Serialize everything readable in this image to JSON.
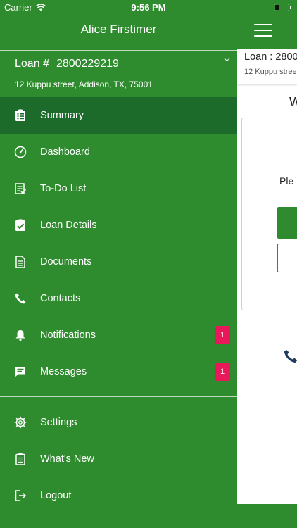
{
  "status_bar": {
    "carrier": "Carrier",
    "time": "9:56 PM"
  },
  "header": {
    "title": "Alice Firstimer"
  },
  "loan": {
    "label": "Loan #",
    "number": "2800229219",
    "address": "12 Kuppu street, Addison, TX, 75001"
  },
  "menu": {
    "items": [
      {
        "label": "Summary",
        "icon": "clipboard-list-icon"
      },
      {
        "label": "Dashboard",
        "icon": "gauge-icon"
      },
      {
        "label": "To-Do List",
        "icon": "checklist-icon"
      },
      {
        "label": "Loan Details",
        "icon": "clipboard-check-icon"
      },
      {
        "label": "Documents",
        "icon": "document-icon"
      },
      {
        "label": "Contacts",
        "icon": "phone-icon"
      },
      {
        "label": "Notifications",
        "icon": "bell-icon",
        "badge": "1"
      },
      {
        "label": "Messages",
        "icon": "chat-icon",
        "badge": "1"
      }
    ],
    "secondary": [
      {
        "label": "Settings",
        "icon": "gear-icon"
      },
      {
        "label": "What's New",
        "icon": "clipboard-icon"
      },
      {
        "label": "Logout",
        "icon": "logout-icon"
      }
    ]
  },
  "content": {
    "loan_header": "Loan : 2800",
    "loan_address": "12 Kuppu stree",
    "heading_fragment": "W",
    "text_fragment": "Ple"
  },
  "colors": {
    "sidebar_bg": "#2e8b2e",
    "active_bg": "#1c6b2b",
    "badge": "#e8185a",
    "content_bg": "#ffffff"
  }
}
